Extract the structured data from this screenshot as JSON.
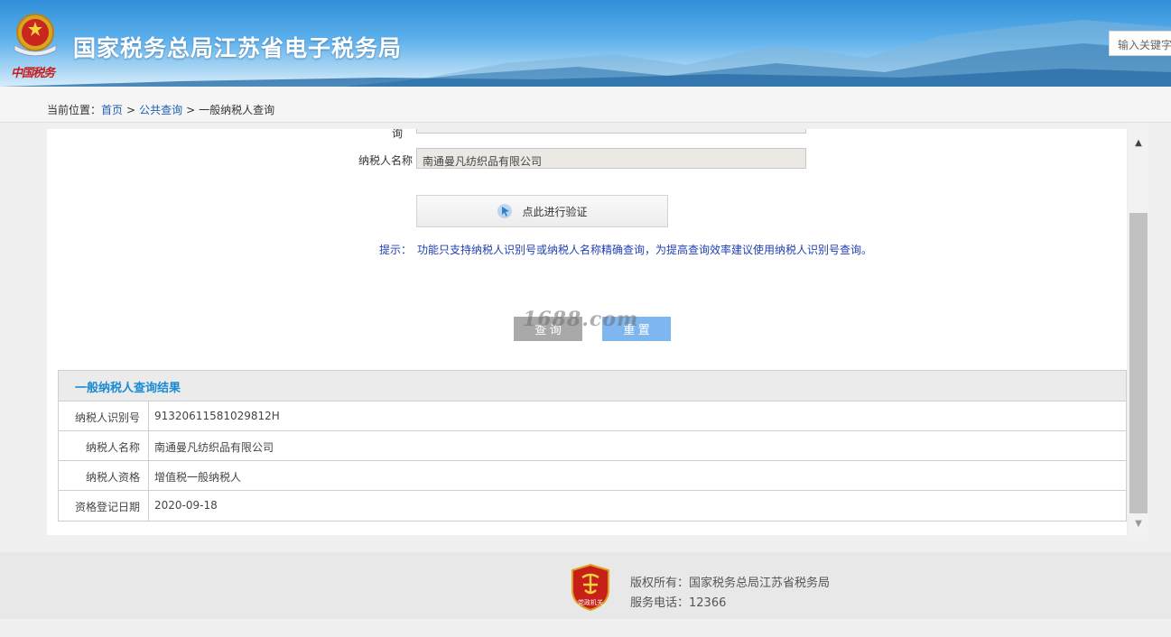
{
  "header": {
    "site_title": "国家税务总局江苏省电子税务局",
    "emblem_script": "中国税务",
    "search_placeholder": "输入关键字"
  },
  "breadcrumb": {
    "prefix": "当前位置：",
    "items": [
      "首页",
      "公共查询",
      "一般纳税人查询"
    ],
    "separator": ">"
  },
  "form": {
    "partial_label": "询",
    "taxpayer_name_label": "纳税人名称",
    "taxpayer_name_value": "南通曼凡纺织品有限公司",
    "verify_button": "点此进行验证",
    "hint_label": "提示：",
    "hint_text": "功能只支持纳税人识别号或纳税人名称精确查询，为提高查询效率建议使用纳税人识别号查询。",
    "query_button": "查 询",
    "reset_button": "重 置",
    "watermark": "1688.com"
  },
  "results": {
    "title": "一般纳税人查询结果",
    "rows": [
      {
        "key": "纳税人识别号",
        "value": "91320611581029812H"
      },
      {
        "key": "纳税人名称",
        "value": "南通曼凡纺织品有限公司"
      },
      {
        "key": "纳税人资格",
        "value": "增值税一般纳税人"
      },
      {
        "key": "资格登记日期",
        "value": "2020-09-18"
      }
    ]
  },
  "footer": {
    "copyright": "版权所有：国家税务总局江苏省税务局",
    "phone": "服务电话：12366",
    "badge_text": "党政机关"
  },
  "colors": {
    "header_blue": "#2f8fd8",
    "link_blue": "#1e5fb4",
    "hint_blue": "#1f3fb0",
    "results_title": "#1a8bd3",
    "reset_button": "#7eb6f0",
    "query_button": "#a9a9a9"
  }
}
